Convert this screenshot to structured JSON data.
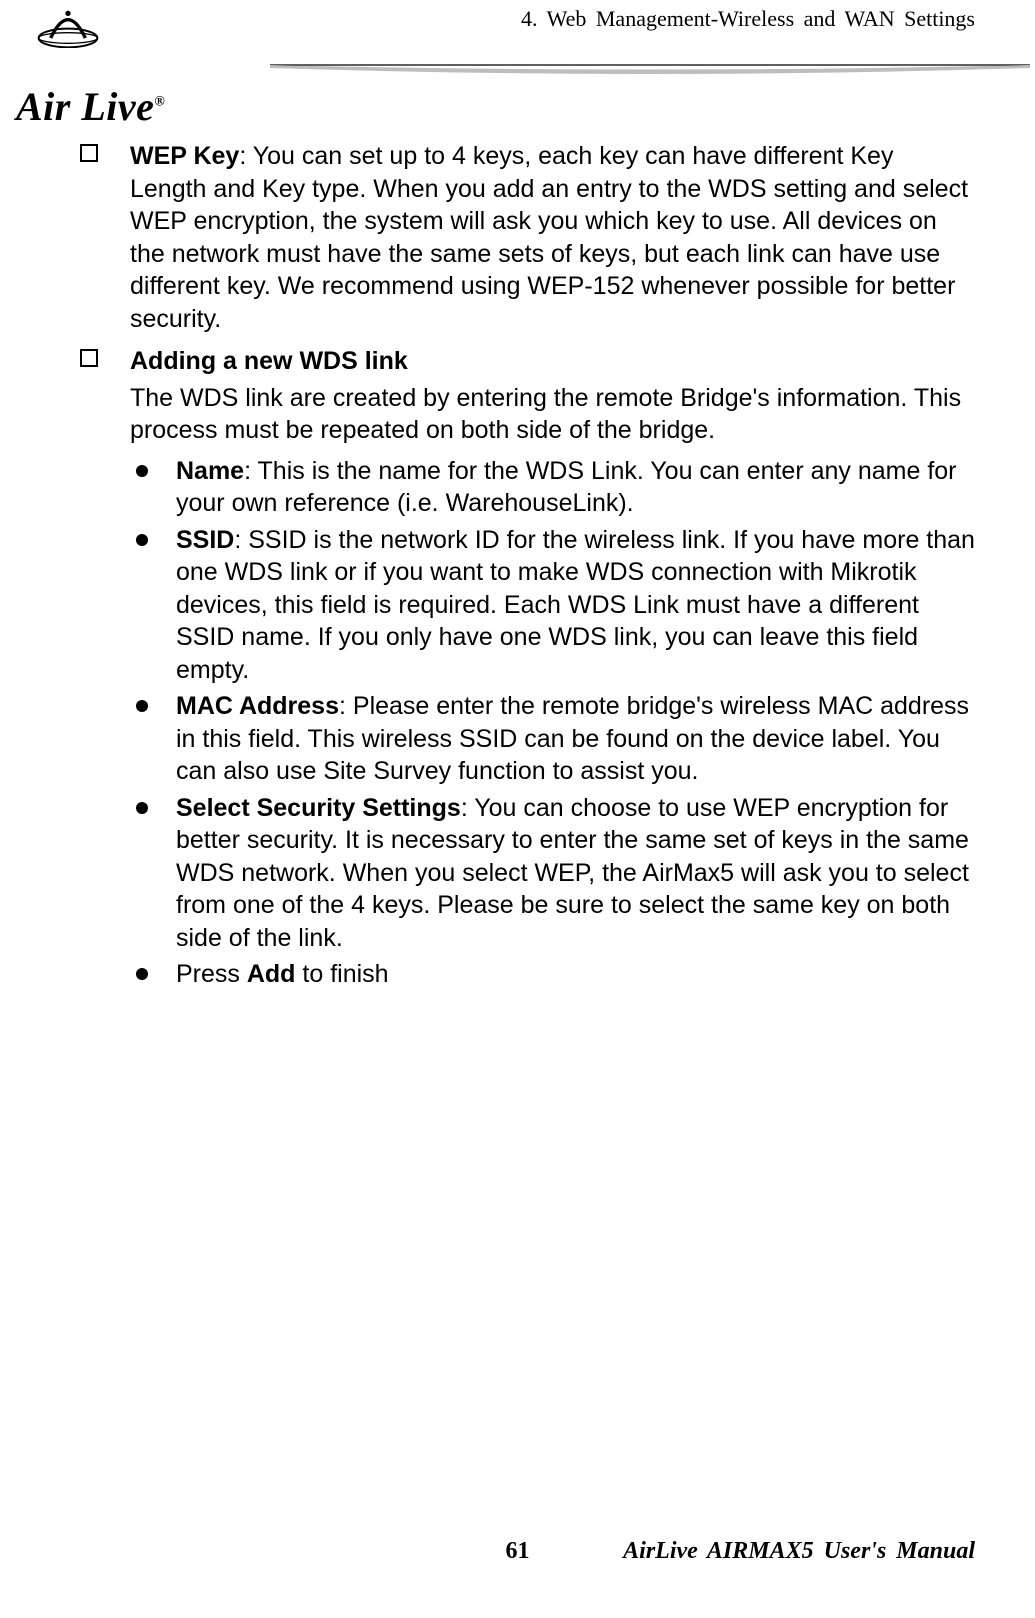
{
  "header": {
    "chapter": "4. Web Management-Wireless and WAN Settings",
    "logo_text": "Air Live",
    "logo_reg": "®"
  },
  "content": {
    "wep_key_label": "WEP Key",
    "wep_key_text": ":   You can set up to 4 keys, each key can have different Key Length and Key type.   When you add an entry to the WDS setting and select WEP encryption, the system will ask you which key to use.   All devices on the network must have the same sets of keys, but each link can have use different key.   We recommend using WEP-152 whenever possible for better security.",
    "adding_heading": "Adding a new WDS link",
    "adding_intro": "The WDS link are created by entering the remote Bridge's information.   This process must be repeated on both side of the bridge.",
    "name_label": "Name",
    "name_text": ": This is the name for the WDS Link.   You can enter any name for your own reference (i.e. WarehouseLink).",
    "ssid_label": "SSID",
    "ssid_text": ":   SSID is the network ID for the wireless link.   If you have more than one WDS link or if you want to make WDS connection with Mikrotik devices, this field is required.   Each WDS Link must have a different SSID name.   If you only have one WDS link, you can leave this field empty.",
    "mac_label": "MAC Address",
    "mac_text": ": Please enter the remote bridge's wireless MAC address in this field.   This wireless SSID can be found on the device label.   You can also use Site Survey function to assist you.",
    "sec_label": "Select Security Settings",
    "sec_text": ": You can choose to use WEP encryption for better security.   It is necessary to enter the same set of keys in the same WDS network.   When you select WEP, the AirMax5 will ask you to select from one of the 4 keys.   Please be sure to select the same key on both side of the link.",
    "press_prefix": "Press ",
    "press_bold": "Add",
    "press_suffix": " to finish"
  },
  "footer": {
    "page": "61",
    "manual": "AirLive AIRMAX5 User's Manual"
  }
}
